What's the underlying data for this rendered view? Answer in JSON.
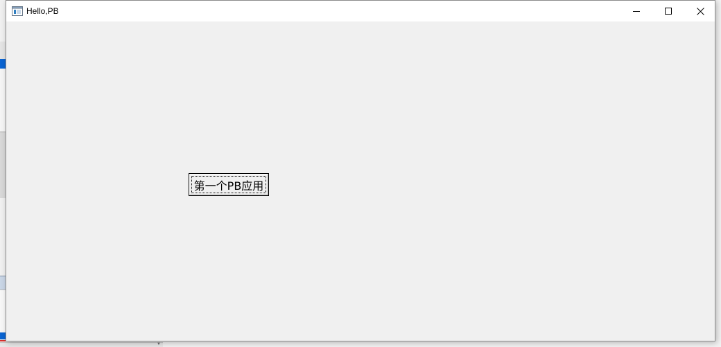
{
  "window": {
    "title": "Hello,PB",
    "icon": "app-window-icon",
    "caption_buttons": {
      "minimize": "minimize-icon",
      "maximize": "maximize-icon",
      "close": "close-icon"
    }
  },
  "client": {
    "button_label": "第一个PB应用"
  },
  "colors": {
    "client_background": "#f0f0f0",
    "titlebar_background": "#ffffff",
    "background_accent": "#0a64d2",
    "background_red_line": "#d9302c"
  }
}
